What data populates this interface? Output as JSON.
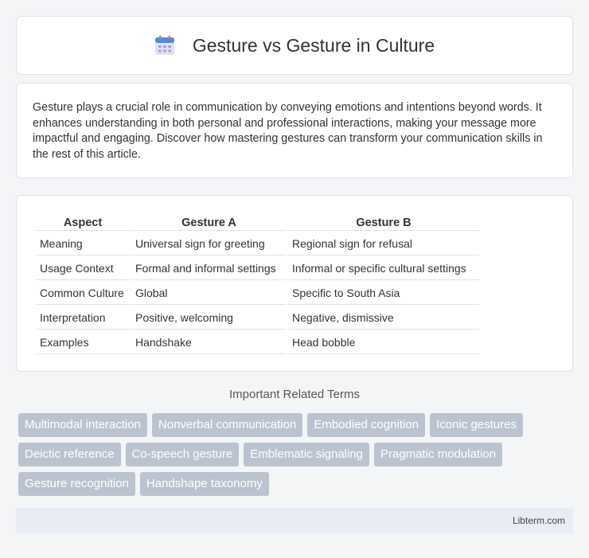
{
  "header": {
    "icon": "calendar-icon",
    "title": "Gesture vs Gesture in Culture"
  },
  "intro": {
    "text": "Gesture plays a crucial role in communication by conveying emotions and intentions beyond words. It enhances understanding in both personal and professional interactions, making your message more impactful and engaging. Discover how mastering gestures can transform your communication skills in the rest of this article."
  },
  "table": {
    "headers": [
      "Aspect",
      "Gesture A",
      "Gesture B"
    ],
    "rows": [
      [
        "Meaning",
        "Universal sign for greeting",
        "Regional sign for refusal"
      ],
      [
        "Usage Context",
        "Formal and informal settings",
        "Informal or specific cultural settings"
      ],
      [
        "Common Culture",
        "Global",
        "Specific to South Asia"
      ],
      [
        "Interpretation",
        "Positive, welcoming",
        "Negative, dismissive"
      ],
      [
        "Examples",
        "Handshake",
        "Head bobble"
      ]
    ]
  },
  "terms": {
    "title": "Important Related Terms",
    "items": [
      "Multimodal interaction",
      "Nonverbal communication",
      "Embodied cognition",
      "Iconic gestures",
      "Deictic reference",
      "Co-speech gesture",
      "Emblematic signaling",
      "Pragmatic modulation",
      "Gesture recognition",
      "Handshape taxonomy"
    ]
  },
  "footer": {
    "site": "Libterm.com"
  },
  "colors": {
    "tag_bg": "#bcc3d0",
    "footer_bg": "#e8ecf5",
    "page_bg": "#f4f5f7"
  }
}
